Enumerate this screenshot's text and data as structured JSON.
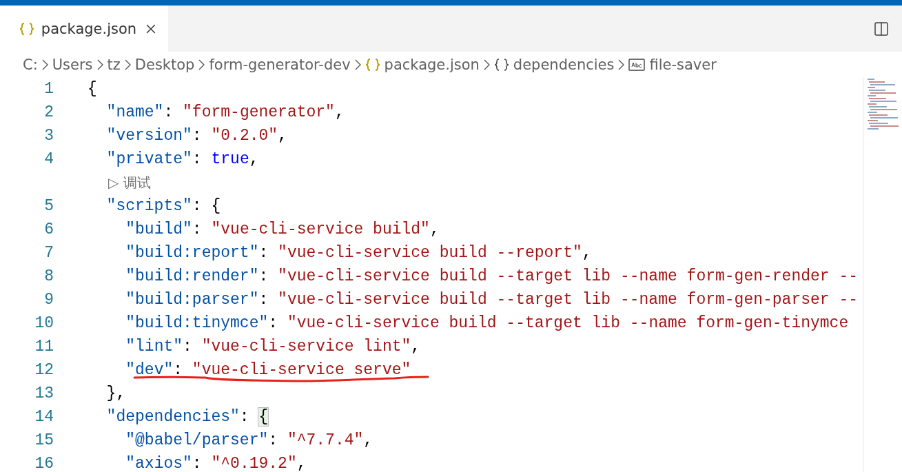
{
  "tabs": [
    {
      "label": "package.json",
      "kind": "json",
      "selected": true
    }
  ],
  "breadcrumb": [
    {
      "label": "C:",
      "kind": "folder"
    },
    {
      "label": "Users",
      "kind": "folder"
    },
    {
      "label": "tz",
      "kind": "folder"
    },
    {
      "label": "Desktop",
      "kind": "folder"
    },
    {
      "label": "form-generator-dev",
      "kind": "folder"
    },
    {
      "label": "package.json",
      "kind": "json"
    },
    {
      "label": "dependencies",
      "kind": "object"
    },
    {
      "label": "file-saver",
      "kind": "string"
    }
  ],
  "lines": [
    {
      "kind": "code",
      "number": "1",
      "text": "{"
    },
    {
      "kind": "code",
      "number": "2",
      "text": "  \"name\": \"form-generator\","
    },
    {
      "kind": "code",
      "number": "3",
      "text": "  \"version\": \"0.2.0\","
    },
    {
      "kind": "code",
      "number": "4",
      "text": "  \"private\": true,"
    },
    {
      "kind": "codelens",
      "text": "▷ 调试"
    },
    {
      "kind": "code",
      "number": "5",
      "text": "  \"scripts\": {"
    },
    {
      "kind": "code",
      "number": "6",
      "text": "    \"build\": \"vue-cli-service build\","
    },
    {
      "kind": "code",
      "number": "7",
      "text": "    \"build:report\": \"vue-cli-service build --report\","
    },
    {
      "kind": "code",
      "number": "8",
      "text": "    \"build:render\": \"vue-cli-service build --target lib --name form-gen-render --"
    },
    {
      "kind": "code",
      "number": "9",
      "text": "    \"build:parser\": \"vue-cli-service build --target lib --name form-gen-parser --"
    },
    {
      "kind": "code",
      "number": "10",
      "text": "    \"build:tinymce\": \"vue-cli-service build --target lib --name form-gen-tinymce"
    },
    {
      "kind": "code",
      "number": "11",
      "text": "    \"lint\": \"vue-cli-service lint\","
    },
    {
      "kind": "code",
      "number": "12",
      "text": "    \"dev\": \"vue-cli-service serve\"",
      "underlined": true
    },
    {
      "kind": "code",
      "number": "13",
      "text": "  },"
    },
    {
      "kind": "code",
      "number": "14",
      "text": "  \"dependencies\": {",
      "bracket_highlight": true
    },
    {
      "kind": "code",
      "number": "15",
      "text": "    \"@babel/parser\": \"^7.7.4\","
    },
    {
      "kind": "code",
      "number": "16",
      "text": "    \"axios\": \"^0.19.2\","
    }
  ]
}
